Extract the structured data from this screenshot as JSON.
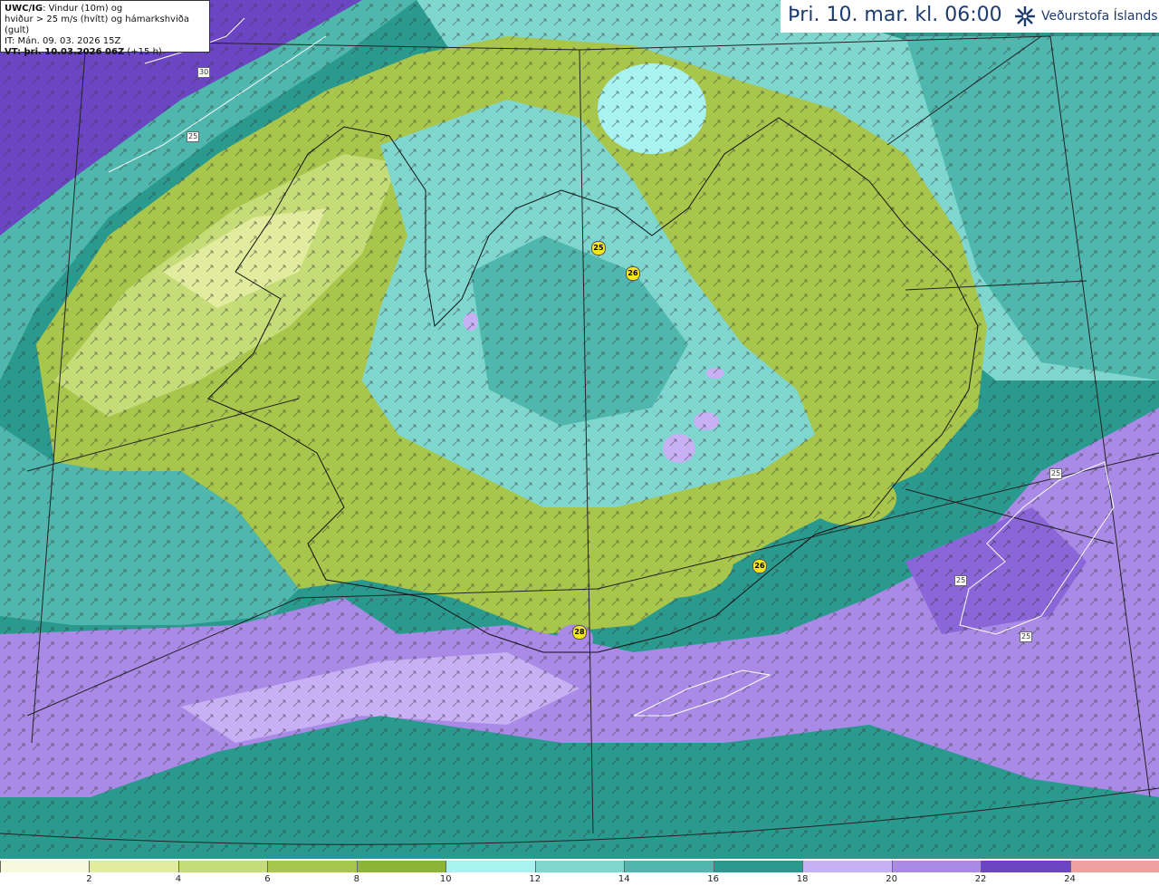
{
  "info": {
    "line1_bold": "UWC/IG",
    "line1_rest": ": Vindur (10m) og",
    "line2": "hviður > 25 m/s (hvítt) og hámarkshviða (gult)",
    "line3": "IT: Mán. 09. 03. 2026 15Z",
    "line4_bold": "VT: þri. 10.03.2026 06Z",
    "line4_rest": " (+15 h)"
  },
  "title": "Þri. 10. mar. kl. 06:00",
  "logo": {
    "text": "Veðurstofa Íslands",
    "icon": "vedurstofa-logo-icon"
  },
  "legend": {
    "colors": [
      "#f8f9dc",
      "#e2ec9e",
      "#c6dc78",
      "#a9c64c",
      "#8db434",
      "#a8f3f2",
      "#7fd6cf",
      "#4fb7ad",
      "#2b9a8e",
      "#1f7f72",
      "#c8b0f5",
      "#a98ae6",
      "#8a66d8",
      "#6b45c4",
      "#4a2aa8",
      "#f0a0a0"
    ],
    "ticks": [
      "2",
      "4",
      "6",
      "8",
      "10",
      "12",
      "14",
      "16",
      "18",
      "20",
      "22",
      "24"
    ]
  },
  "gust_markers": [
    "25",
    "26",
    "26",
    "28"
  ],
  "isoline_labels": [
    "30",
    "25",
    "25",
    "25",
    "25"
  ]
}
